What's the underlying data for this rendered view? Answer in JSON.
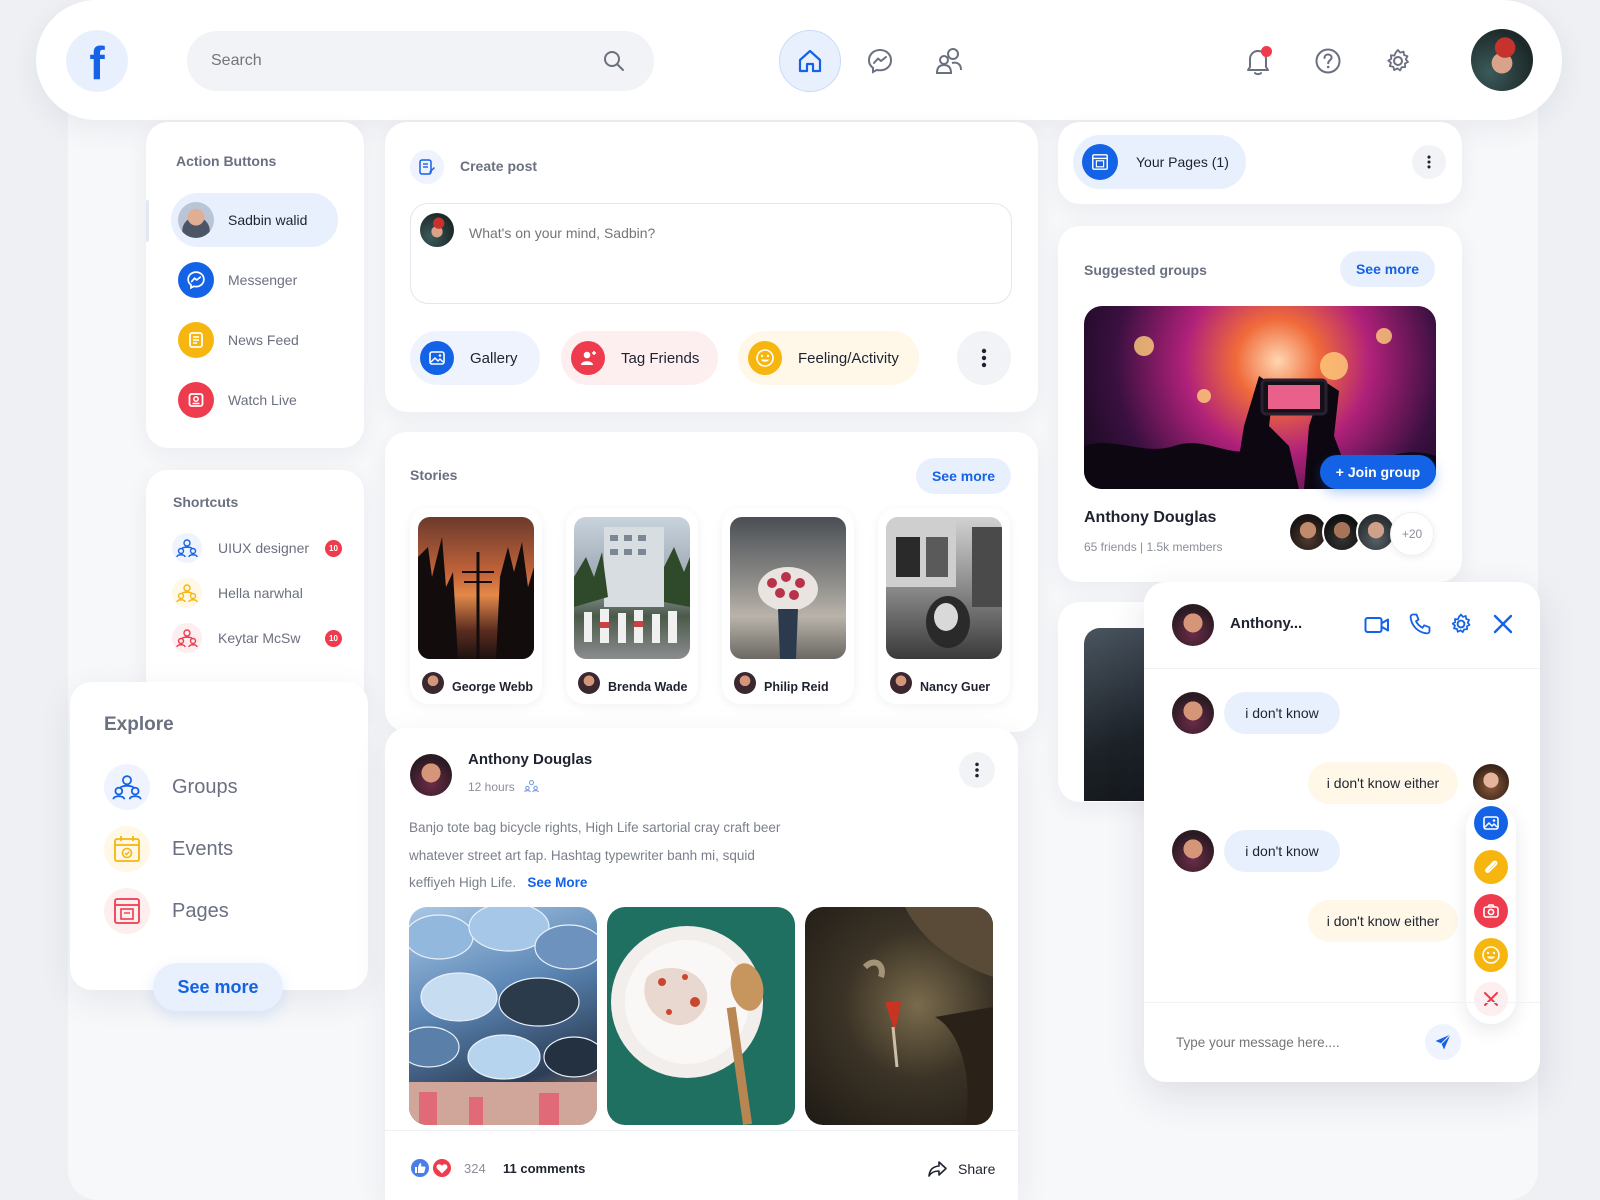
{
  "header": {
    "logo_letter": "f",
    "search_placeholder": "Search",
    "nav_icons": [
      "home-icon",
      "messenger-icon",
      "friends-icon"
    ],
    "right_icons": [
      "bell-icon",
      "help-icon",
      "gear-icon"
    ],
    "notification_dot_color": "#ee3c4e"
  },
  "sidebar": {
    "action_title": "Action Buttons",
    "items": [
      {
        "label": "Sadbin walid",
        "icon": "avatar"
      },
      {
        "label": "Messenger",
        "icon": "messenger-icon",
        "color": "#1463e6"
      },
      {
        "label": "News Feed",
        "icon": "news-icon",
        "color": "#f6b60f"
      },
      {
        "label": "Watch Live",
        "icon": "live-icon",
        "color": "#ee3c4e"
      }
    ],
    "shortcuts_title": "Shortcuts",
    "shortcuts": [
      {
        "label": "UIUX designer",
        "badge": "10",
        "color": "#1463e6"
      },
      {
        "label": "Hella narwhal",
        "badge": "",
        "color": "#f6b60f"
      },
      {
        "label": "Keytar McSw",
        "badge": "10",
        "color": "#ee3c4e"
      }
    ]
  },
  "explore": {
    "title": "Explore",
    "items": [
      {
        "label": "Groups",
        "icon": "groups-icon"
      },
      {
        "label": "Events",
        "icon": "calendar-icon"
      },
      {
        "label": "Pages",
        "icon": "pages-icon"
      }
    ],
    "see_more": "See more"
  },
  "create_post": {
    "title": "Create post",
    "placeholder": "What's on your mind, Sadbin?",
    "actions": [
      {
        "label": "Gallery",
        "color": "#1463e6"
      },
      {
        "label": "Tag Friends",
        "color": "#ee3c4e"
      },
      {
        "label": "Feeling/Activity",
        "color": "#f6b60f"
      }
    ]
  },
  "stories": {
    "title": "Stories",
    "see_more": "See more",
    "items": [
      {
        "name": "George Webb"
      },
      {
        "name": "Brenda Wade"
      },
      {
        "name": "Philip Reid"
      },
      {
        "name": "Nancy Guer"
      }
    ]
  },
  "post": {
    "author": "Anthony Douglas",
    "time": "12 hours",
    "text_lines": [
      "Banjo tote bag bicycle rights, High Life sartorial cray craft beer",
      "whatever street art fap. Hashtag typewriter banh mi, squid",
      "keffiyeh High Life."
    ],
    "see_more": "See More",
    "reactions_count": "324",
    "comments": "11 comments",
    "share": "Share"
  },
  "your_pages": {
    "label": "Your Pages (1)"
  },
  "suggested_groups": {
    "title": "Suggested groups",
    "see_more": "See more",
    "join_label": "+ Join group",
    "group_name": "Anthony Douglas",
    "meta": "65 friends | 1.5k members",
    "more_count": "+20"
  },
  "chat": {
    "name": "Anthony...",
    "header_icons": [
      "video-icon",
      "phone-icon",
      "gear-icon",
      "close-icon"
    ],
    "messages": [
      {
        "text": "i don't know",
        "dir": "in"
      },
      {
        "text": "i don't know either",
        "dir": "out"
      },
      {
        "text": "i don't know",
        "dir": "in"
      },
      {
        "text": "i don't know either",
        "dir": "out"
      }
    ],
    "input_placeholder": "Type your message here....",
    "tools": [
      {
        "icon": "gallery-icon",
        "color": "#1463e6"
      },
      {
        "icon": "attach-icon",
        "color": "#f6b60f"
      },
      {
        "icon": "camera-icon",
        "color": "#ee3c4e"
      },
      {
        "icon": "emoji-icon",
        "color": "#f6b60f"
      },
      {
        "icon": "close-icon",
        "color": "#ee3c4e"
      }
    ]
  }
}
